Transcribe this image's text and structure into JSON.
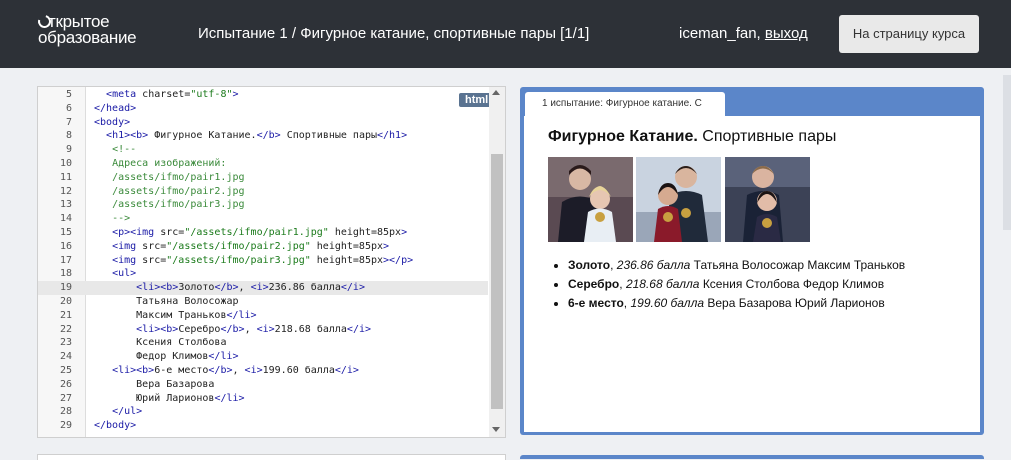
{
  "header": {
    "logo_line1": "ткрытое",
    "logo_line2": "образование",
    "test_label": "Испытание 1",
    "test_separator": " / ",
    "test_name": "Фигурное катание, спортивные пары [1/1]",
    "username": "iceman_fan,",
    "logout": "выход",
    "course_button": "На страницу курса"
  },
  "editor": {
    "language_badge": "html",
    "active_line": 19,
    "lines": [
      {
        "n": "5",
        "t": [
          [
            "  ",
            ""
          ],
          [
            "<meta",
            "t"
          ],
          [
            " charset=",
            "a"
          ],
          [
            "\"utf-8\"",
            "s"
          ],
          [
            ">",
            "t"
          ]
        ]
      },
      {
        "n": "6",
        "t": [
          [
            "",
            ""
          ],
          [
            "</head>",
            "t"
          ]
        ]
      },
      {
        "n": "7",
        "t": [
          [
            "",
            ""
          ],
          [
            "<body>",
            "t"
          ]
        ]
      },
      {
        "n": "8",
        "t": [
          [
            "  ",
            ""
          ],
          [
            "<h1><b>",
            "t"
          ],
          [
            " Фигурное Катание.",
            "a"
          ],
          [
            "</b>",
            "t"
          ],
          [
            " Спортивные пары",
            "a"
          ],
          [
            "</h1>",
            "t"
          ]
        ]
      },
      {
        "n": "9",
        "t": [
          [
            "   ",
            ""
          ],
          [
            "<!--",
            "c"
          ]
        ]
      },
      {
        "n": "10",
        "t": [
          [
            "   ",
            ""
          ],
          [
            "Адреса изображений:",
            "c"
          ]
        ]
      },
      {
        "n": "11",
        "t": [
          [
            "   ",
            ""
          ],
          [
            "/assets/ifmo/pair1.jpg",
            "c"
          ]
        ]
      },
      {
        "n": "12",
        "t": [
          [
            "   ",
            ""
          ],
          [
            "/assets/ifmo/pair2.jpg",
            "c"
          ]
        ]
      },
      {
        "n": "13",
        "t": [
          [
            "   ",
            ""
          ],
          [
            "/assets/ifmo/pair3.jpg",
            "c"
          ]
        ]
      },
      {
        "n": "14",
        "t": [
          [
            "   ",
            ""
          ],
          [
            "-->",
            "c"
          ]
        ]
      },
      {
        "n": "15",
        "t": [
          [
            "   ",
            ""
          ],
          [
            "<p><img",
            "t"
          ],
          [
            " src=",
            "a"
          ],
          [
            "\"/assets/ifmo/pair1.jpg\"",
            "s"
          ],
          [
            " height=85px",
            "a"
          ],
          [
            ">",
            "t"
          ]
        ]
      },
      {
        "n": "16",
        "t": [
          [
            "   ",
            ""
          ],
          [
            "<img",
            "t"
          ],
          [
            " src=",
            "a"
          ],
          [
            "\"/assets/ifmo/pair2.jpg\"",
            "s"
          ],
          [
            " height=85px",
            "a"
          ],
          [
            ">",
            "t"
          ]
        ]
      },
      {
        "n": "17",
        "t": [
          [
            "   ",
            ""
          ],
          [
            "<img",
            "t"
          ],
          [
            " src=",
            "a"
          ],
          [
            "\"/assets/ifmo/pair3.jpg\"",
            "s"
          ],
          [
            " height=85px",
            "a"
          ],
          [
            "></p>",
            "t"
          ]
        ]
      },
      {
        "n": "18",
        "t": [
          [
            "   ",
            ""
          ],
          [
            "<ul>",
            "t"
          ]
        ]
      },
      {
        "n": "19",
        "t": [
          [
            "       ",
            ""
          ],
          [
            "<li><b>",
            "t"
          ],
          [
            "Золото",
            "a"
          ],
          [
            "</b>",
            "t"
          ],
          [
            ", ",
            "a"
          ],
          [
            "<i>",
            "t"
          ],
          [
            "236.86 балла",
            "a"
          ],
          [
            "</i>",
            "t"
          ]
        ]
      },
      {
        "n": "20",
        "t": [
          [
            "       ",
            ""
          ],
          [
            "Татьяна Волосожар",
            "a"
          ]
        ]
      },
      {
        "n": "21",
        "t": [
          [
            "       ",
            ""
          ],
          [
            "Максим Траньков",
            "a"
          ],
          [
            "</li>",
            "t"
          ]
        ]
      },
      {
        "n": "22",
        "t": [
          [
            "       ",
            ""
          ],
          [
            "<li><b>",
            "t"
          ],
          [
            "Серебро",
            "a"
          ],
          [
            "</b>",
            "t"
          ],
          [
            ", ",
            "a"
          ],
          [
            "<i>",
            "t"
          ],
          [
            "218.68 балла",
            "a"
          ],
          [
            "</i>",
            "t"
          ]
        ]
      },
      {
        "n": "23",
        "t": [
          [
            "       ",
            ""
          ],
          [
            "Ксения Столбова",
            "a"
          ]
        ]
      },
      {
        "n": "24",
        "t": [
          [
            "       ",
            ""
          ],
          [
            "Федор Климов",
            "a"
          ],
          [
            "</li>",
            "t"
          ]
        ]
      },
      {
        "n": "25",
        "t": [
          [
            "   ",
            ""
          ],
          [
            "<li><b>",
            "t"
          ],
          [
            "6-е место",
            "a"
          ],
          [
            "</b>",
            "t"
          ],
          [
            ", ",
            "a"
          ],
          [
            "<i>",
            "t"
          ],
          [
            "199.60 балла",
            "a"
          ],
          [
            "</i>",
            "t"
          ]
        ]
      },
      {
        "n": "26",
        "t": [
          [
            "       ",
            ""
          ],
          [
            "Вера Базарова",
            "a"
          ]
        ]
      },
      {
        "n": "27",
        "t": [
          [
            "       ",
            ""
          ],
          [
            "Юрий Ларионов",
            "a"
          ],
          [
            "</li>",
            "t"
          ]
        ]
      },
      {
        "n": "28",
        "t": [
          [
            "   ",
            ""
          ],
          [
            "</ul>",
            "t"
          ]
        ]
      },
      {
        "n": "29",
        "t": [
          [
            "",
            ""
          ],
          [
            "</body>",
            "t"
          ]
        ]
      }
    ]
  },
  "preview": {
    "tab_label": "1 испытание: Фигурное катание. С",
    "title_bold": "Фигурное Катание.",
    "title_rest": " Спортивные пары",
    "images": [
      {
        "name": "pair1-photo"
      },
      {
        "name": "pair2-photo"
      },
      {
        "name": "pair3-photo"
      }
    ],
    "results": [
      {
        "place": "Золото",
        "score": "236.86 балла",
        "names": " Татьяна Волосожар Максим Траньков"
      },
      {
        "place": "Серебро",
        "score": "218.68 балла",
        "names": " Ксения Столбова Федор Климов"
      },
      {
        "place": "6-е место",
        "score": "199.60 балла",
        "names": " Вера Базарова Юрий Ларионов"
      }
    ]
  }
}
